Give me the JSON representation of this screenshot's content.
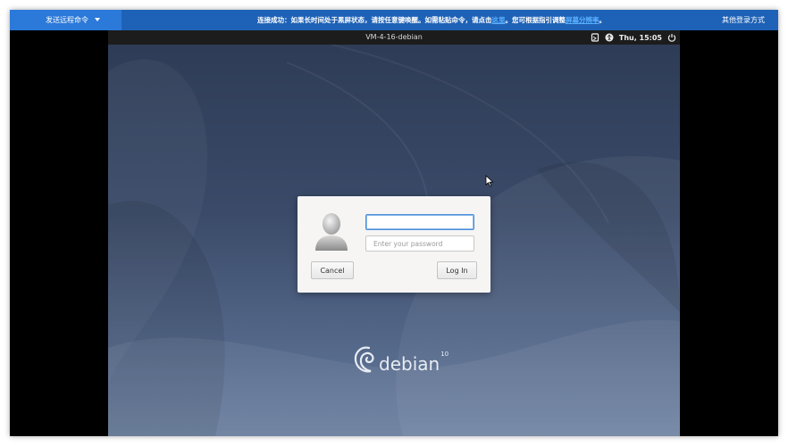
{
  "toolbar": {
    "send_command_label": "发送远程命令",
    "notice_prefix": "连接成功：如果长时间处于黑屏状态，请按任意键唤醒。如需粘贴命令，请点击",
    "notice_link_paste": "这里",
    "notice_middle": "。您可根据指引调整",
    "notice_link_resolution": "屏幕分辨率",
    "notice_suffix": "。",
    "other_login_label": "其他登录方式",
    "colors": {
      "bar": "#1e62b7",
      "button": "#2b79d9",
      "link": "#5ab0ff"
    }
  },
  "remote": {
    "hostname": "VM-4-16-debian",
    "clock": "Thu, 15:05",
    "tray_icons": [
      "screen-reader-icon",
      "accessibility-icon",
      "power-icon"
    ]
  },
  "login_dialog": {
    "avatar_icon": "user-avatar-icon",
    "username_value": "",
    "password_placeholder": "Enter your password",
    "cancel_label": "Cancel",
    "login_label": "Log In"
  },
  "branding": {
    "logo_text": "debian",
    "version": "10"
  }
}
